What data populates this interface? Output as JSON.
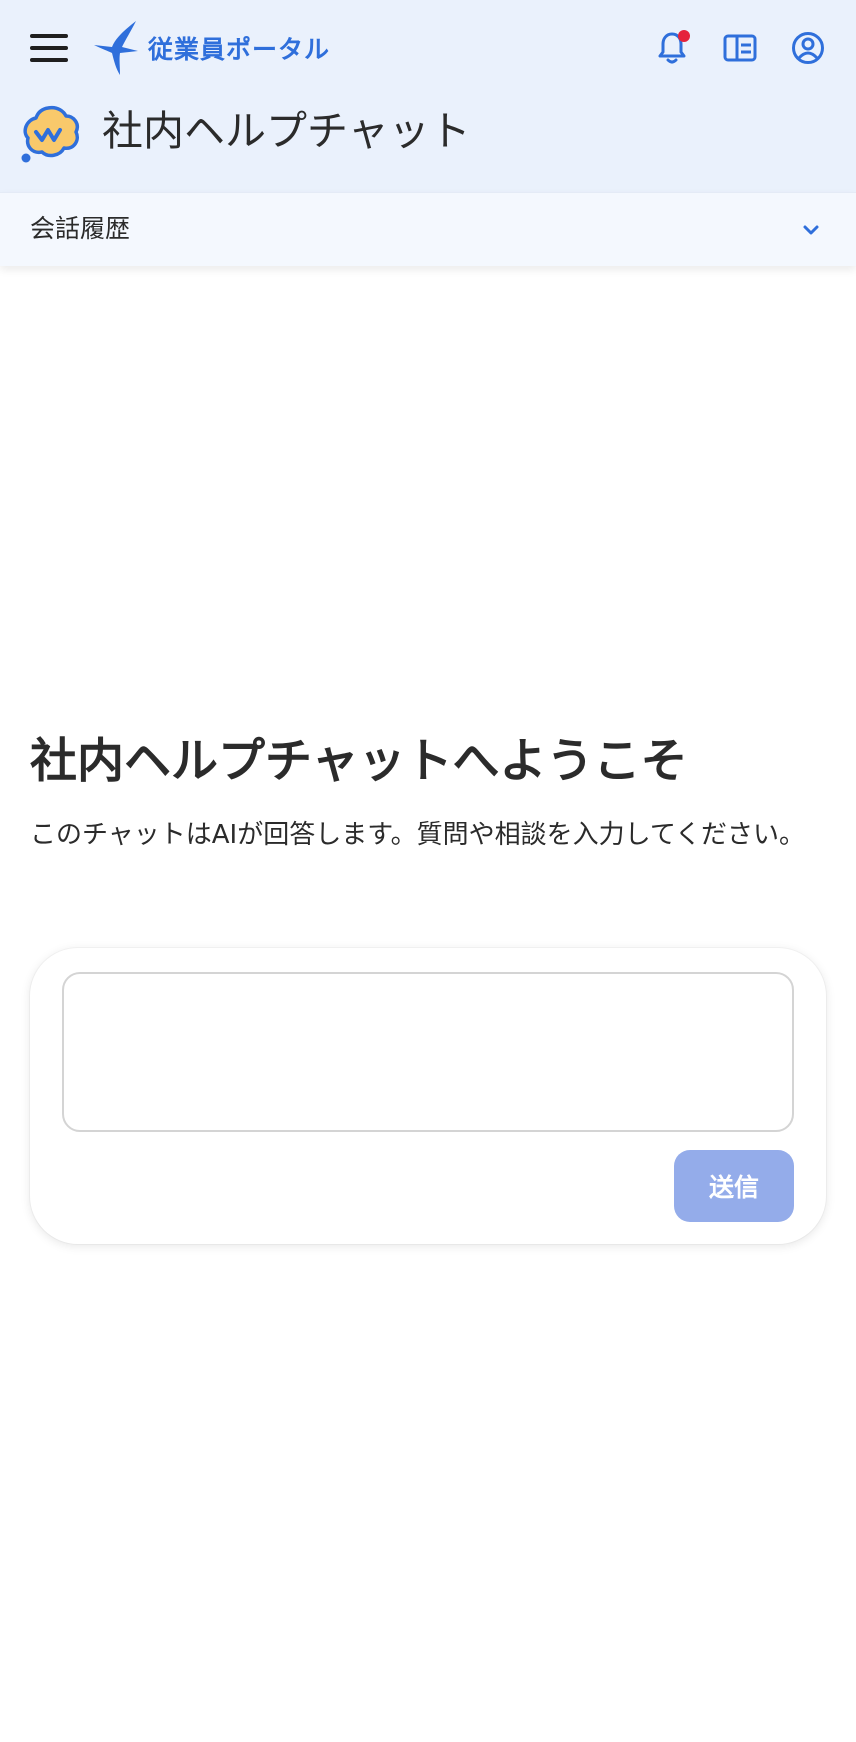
{
  "portal": {
    "name": "従業員ポータル"
  },
  "app": {
    "title": "社内ヘルプチャット"
  },
  "history": {
    "label": "会話履歴"
  },
  "welcome": {
    "title": "社内ヘルプチャットへようこそ",
    "description": "このチャットはAIが回答します。質問や相談を入力してください。"
  },
  "chat": {
    "input_value": "",
    "send_label": "送信"
  },
  "icons": {
    "menu": "hamburger-menu-icon",
    "logo": "swallow-logo-icon",
    "notifications": "bell-icon",
    "directory": "id-card-icon",
    "account": "account-circle-icon",
    "app": "chat-bubble-icon",
    "expand": "chevron-down-icon"
  },
  "colors": {
    "header_bg": "#eaf1fc",
    "history_bg": "#f4f8fe",
    "accent": "#2f6fdb",
    "notification_dot": "#e5233b",
    "send_disabled": "#94acea",
    "app_icon_fill": "#f9c96b"
  }
}
